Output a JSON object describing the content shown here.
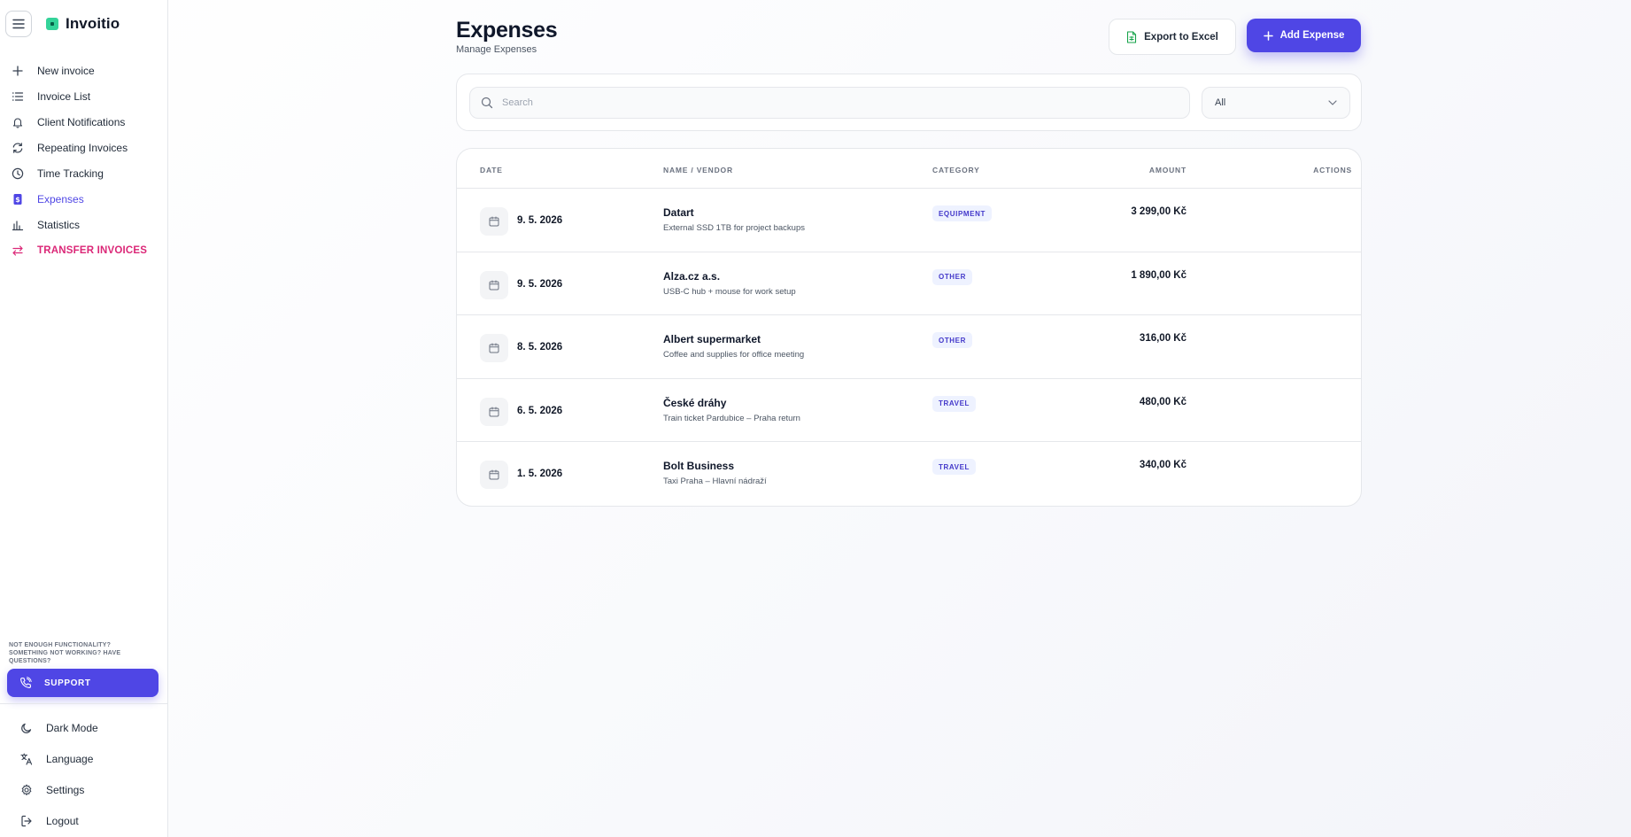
{
  "app": {
    "name": "Invoitio"
  },
  "sidebar": {
    "items": [
      {
        "label": "New invoice",
        "icon": "plus-icon"
      },
      {
        "label": "Invoice List",
        "icon": "list-icon"
      },
      {
        "label": "Client Notifications",
        "icon": "bell-icon"
      },
      {
        "label": "Repeating Invoices",
        "icon": "refresh-icon"
      },
      {
        "label": "Time Tracking",
        "icon": "clock-icon"
      },
      {
        "label": "Expenses",
        "icon": "receipt-icon",
        "active": true
      },
      {
        "label": "Statistics",
        "icon": "bar-chart-icon"
      },
      {
        "label": "TRANSFER INVOICES",
        "icon": "transfer-icon"
      }
    ],
    "help_text": "NOT ENOUGH FUNCTIONALITY? SOMETHING NOT WORKING? HAVE QUESTIONS?",
    "support_label": "SUPPORT",
    "bottom": [
      {
        "label": "Dark Mode",
        "icon": "moon-icon"
      },
      {
        "label": "Language",
        "icon": "translate-icon"
      },
      {
        "label": "Settings",
        "icon": "gear-icon"
      },
      {
        "label": "Logout",
        "icon": "logout-icon"
      }
    ]
  },
  "header": {
    "title": "Expenses",
    "subtitle": "Manage Expenses",
    "export_label": "Export to Excel",
    "add_label": "Add Expense"
  },
  "filters": {
    "search_placeholder": "Search",
    "search_value": "",
    "category_selected": "All"
  },
  "table": {
    "columns": {
      "date": "DATE",
      "name": "NAME / VENDOR",
      "category": "CATEGORY",
      "amount": "AMOUNT",
      "actions": "ACTIONS"
    },
    "rows": [
      {
        "date": "9. 5. 2026",
        "vendor": "Datart",
        "description": "External SSD 1TB for project backups",
        "category": "EQUIPMENT",
        "amount": "3 299,00 Kč"
      },
      {
        "date": "9. 5. 2026",
        "vendor": "Alza.cz a.s.",
        "description": "USB-C hub + mouse for work setup",
        "category": "OTHER",
        "amount": "1 890,00 Kč"
      },
      {
        "date": "8. 5. 2026",
        "vendor": "Albert supermarket",
        "description": "Coffee and supplies for office meeting",
        "category": "OTHER",
        "amount": "316,00 Kč"
      },
      {
        "date": "6. 5. 2026",
        "vendor": "České dráhy",
        "description": "Train ticket Pardubice – Praha return",
        "category": "TRAVEL",
        "amount": "480,00 Kč"
      },
      {
        "date": "1. 5. 2026",
        "vendor": "Bolt Business",
        "description": "Taxi Praha – Hlavní nádraží",
        "category": "TRAVEL",
        "amount": "340,00 Kč"
      }
    ]
  },
  "colors": {
    "accent": "#4f46e5",
    "transfer": "#db2777",
    "badge_bg": "#eef2ff",
    "badge_text": "#4338ca",
    "brand_mark": "#34d399"
  }
}
